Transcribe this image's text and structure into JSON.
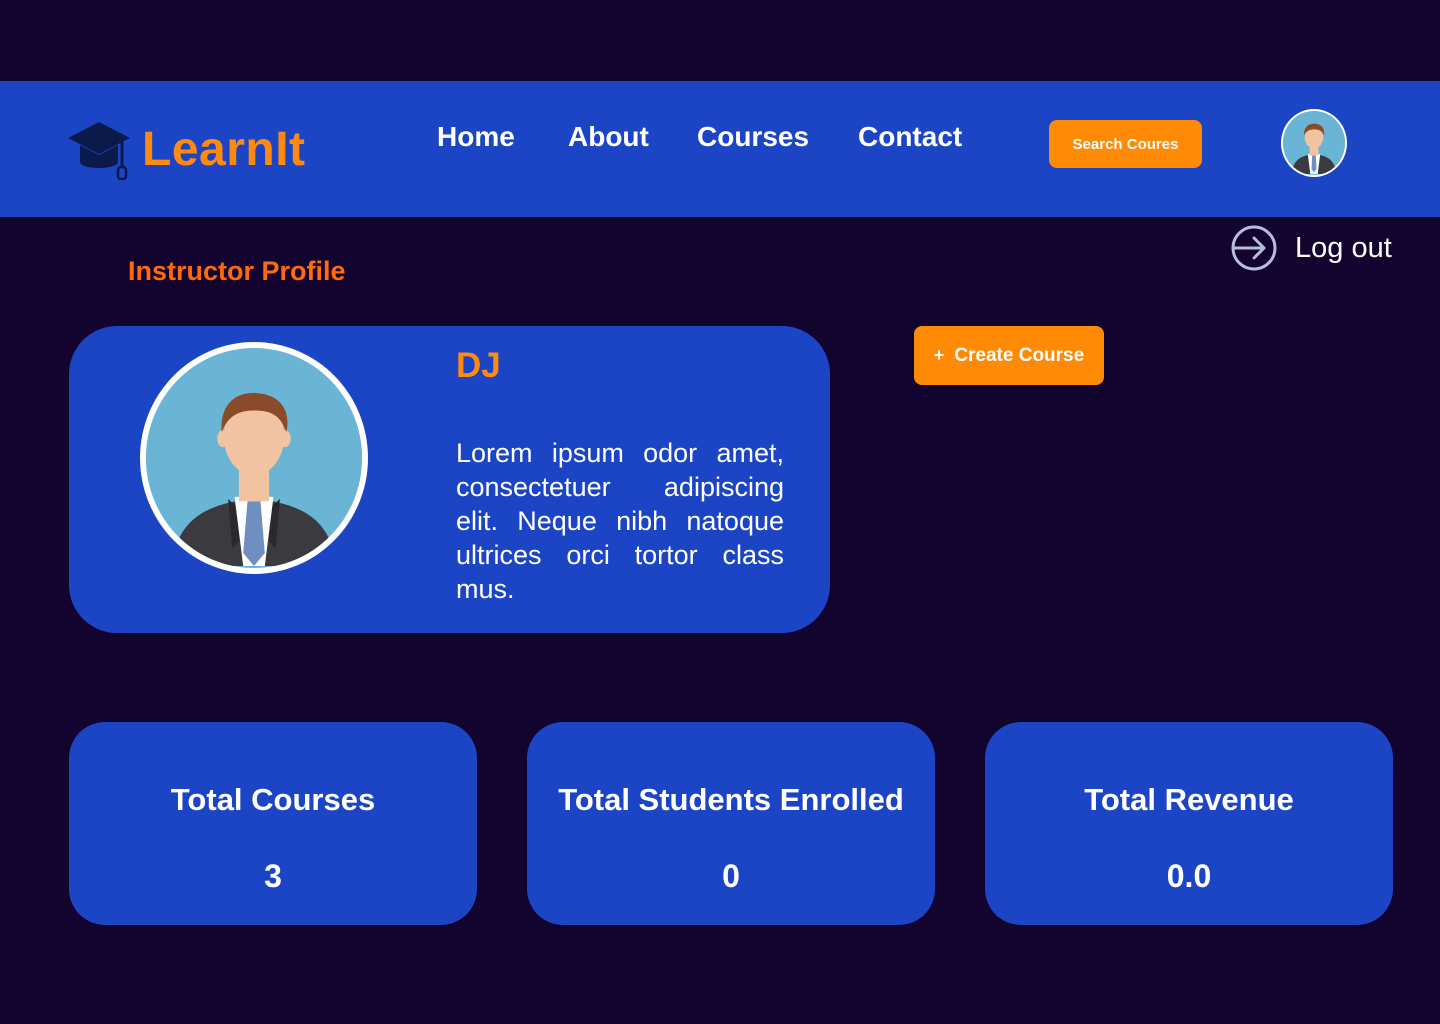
{
  "header": {
    "brand": "LearnIt",
    "nav": [
      "Home",
      "About",
      "Courses",
      "Contact"
    ],
    "search_label": "Search Coures"
  },
  "logout_label": "Log out",
  "page_title": "Instructor Profile",
  "profile": {
    "name": "DJ",
    "bio": "Lorem ipsum odor amet, consectetuer adipiscing elit. Neque nibh natoque ultrices orci tortor class mus."
  },
  "create_course": {
    "icon": "+",
    "label": "Create Course"
  },
  "stats": [
    {
      "label": "Total Courses",
      "value": "3"
    },
    {
      "label": "Total Students Enrolled",
      "value": "0"
    },
    {
      "label": "Total Revenue",
      "value": "0.0"
    }
  ],
  "colors": {
    "background": "#12032f",
    "primary": "#1c45c6",
    "accent": "#ff8a05",
    "title": "#ff6a0f"
  },
  "icons": {
    "logo": "graduation-cap-icon",
    "logout": "logout-arrow-icon",
    "avatar": "businessman-avatar"
  }
}
